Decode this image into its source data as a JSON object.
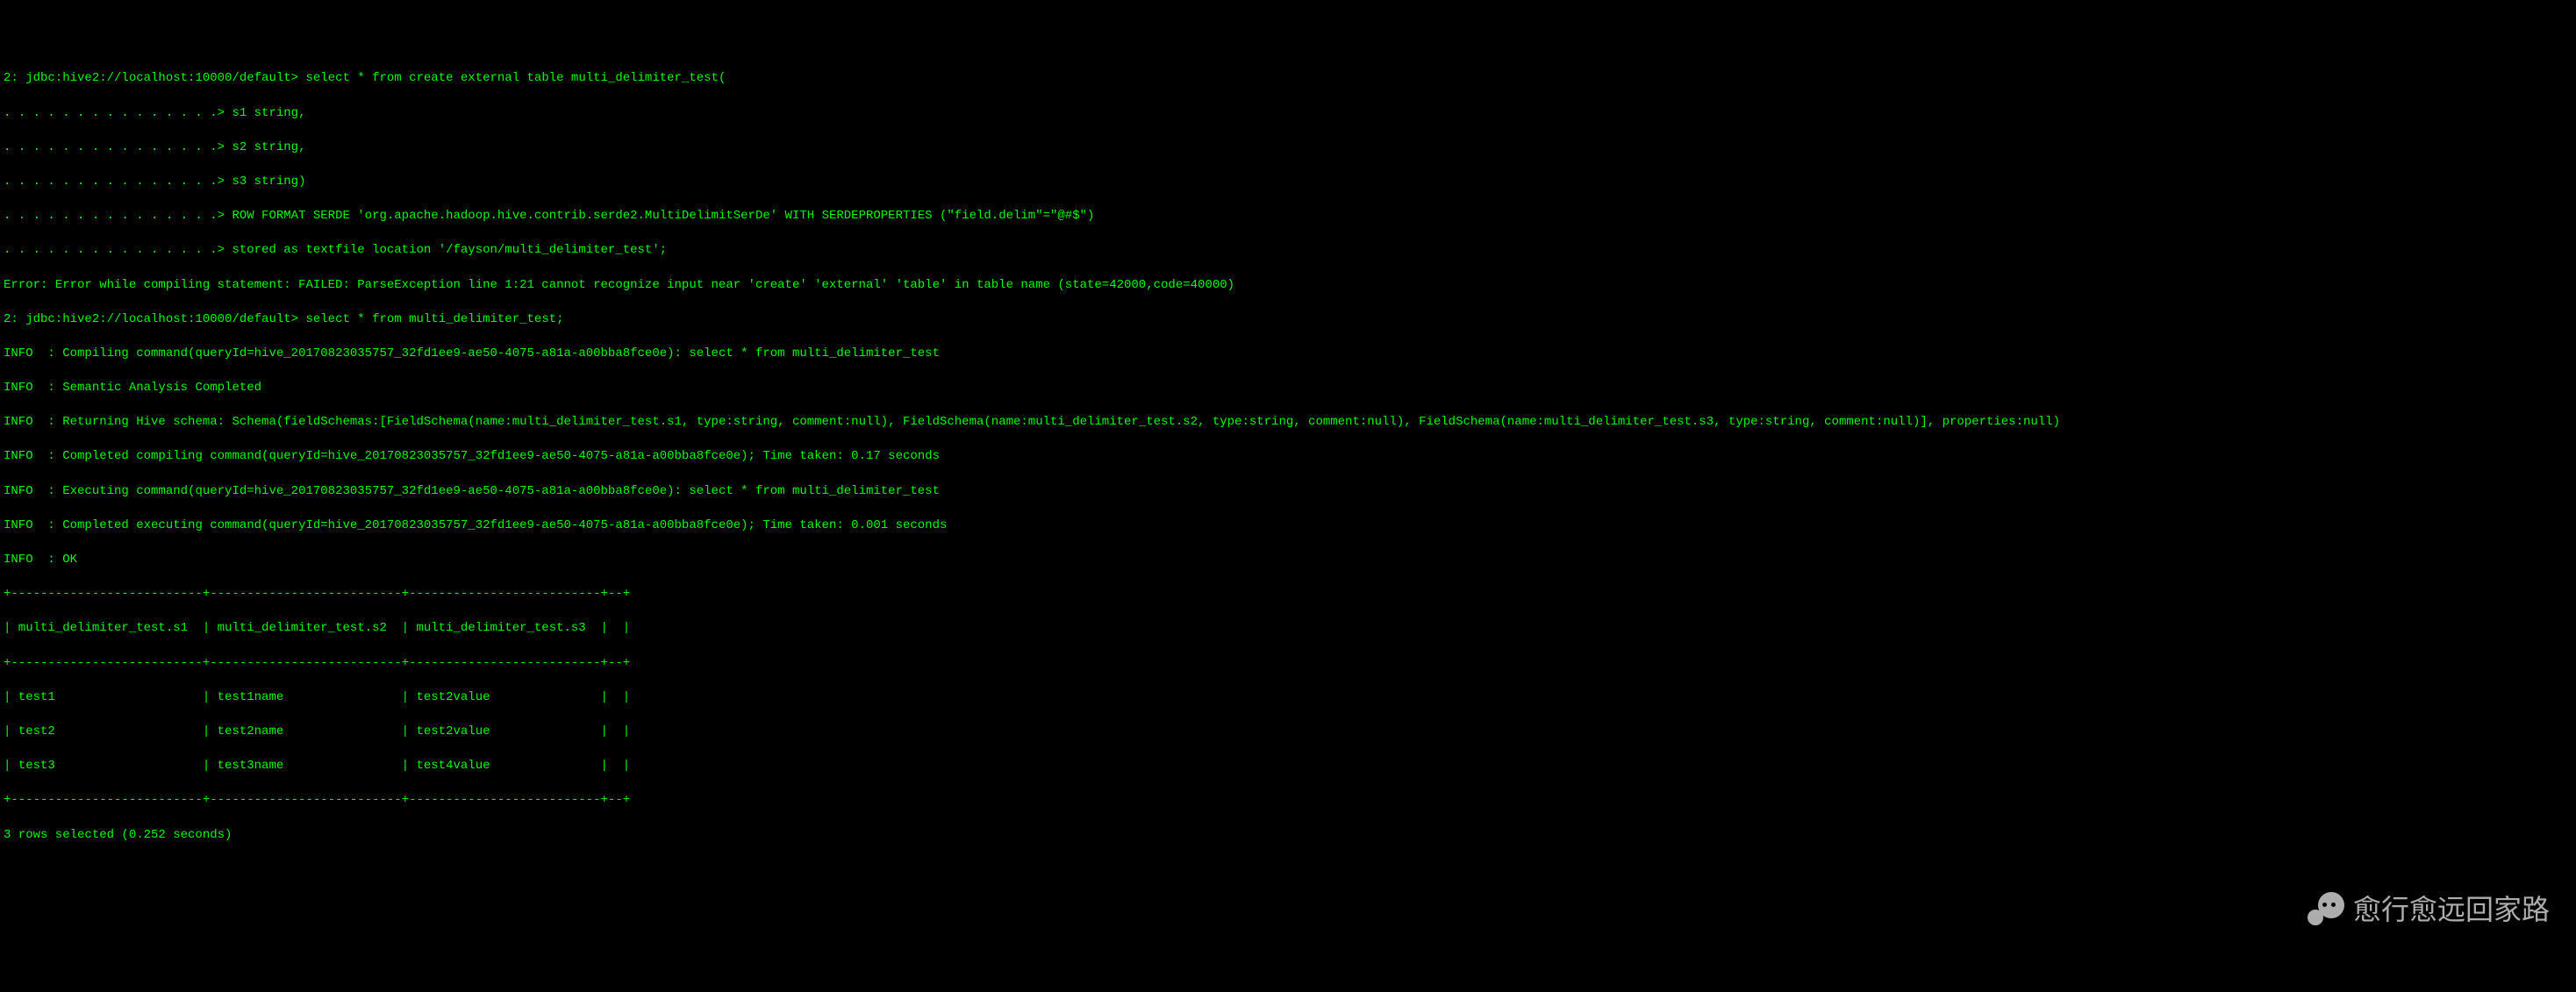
{
  "session": {
    "prompt1": "2: jdbc:hive2://localhost:10000/default> ",
    "continuation_prefix": ". . . . . . . . . . . . . . .> ",
    "query1_line1": "select * from create external table multi_delimiter_test(",
    "query1_line2": "s1 string,",
    "query1_line3": "s2 string,",
    "query1_line4": "s3 string)",
    "query1_line5": "ROW FORMAT SERDE 'org.apache.hadoop.hive.contrib.serde2.MultiDelimitSerDe' WITH SERDEPROPERTIES (\"field.delim\"=\"@#$\")",
    "query1_line6": "stored as textfile location '/fayson/multi_delimiter_test';",
    "error_line": "Error: Error while compiling statement: FAILED: ParseException line 1:21 cannot recognize input near 'create' 'external' 'table' in table name (state=42000,code=40000)",
    "query2": "select * from multi_delimiter_test;",
    "info_label": "INFO  : ",
    "info1": "Compiling command(queryId=hive_20170823035757_32fd1ee9-ae50-4075-a81a-a00bba8fce0e): select * from multi_delimiter_test",
    "info2": "Semantic Analysis Completed",
    "info3": "Returning Hive schema: Schema(fieldSchemas:[FieldSchema(name:multi_delimiter_test.s1, type:string, comment:null), FieldSchema(name:multi_delimiter_test.s2, type:string, comment:null), FieldSchema(name:multi_delimiter_test.s3, type:string, comment:null)], properties:null)",
    "info4": "Completed compiling command(queryId=hive_20170823035757_32fd1ee9-ae50-4075-a81a-a00bba8fce0e); Time taken: 0.17 seconds",
    "info5": "Executing command(queryId=hive_20170823035757_32fd1ee9-ae50-4075-a81a-a00bba8fce0e): select * from multi_delimiter_test",
    "info6": "Completed executing command(queryId=hive_20170823035757_32fd1ee9-ae50-4075-a81a-a00bba8fce0e); Time taken: 0.001 seconds",
    "info7": "OK"
  },
  "table": {
    "border": "+--------------------------+--------------------------+--------------------------+--+",
    "header": "| multi_delimiter_test.s1  | multi_delimiter_test.s2  | multi_delimiter_test.s3  |  |",
    "row1": "| test1                    | test1name                | test2value               |  |",
    "row2": "| test2                    | test2name                | test2value               |  |",
    "row3": "| test3                    | test3name                | test4value               |  |",
    "footer": "3 rows selected (0.252 seconds)"
  },
  "watermark": {
    "text": "愈行愈远回家路"
  }
}
